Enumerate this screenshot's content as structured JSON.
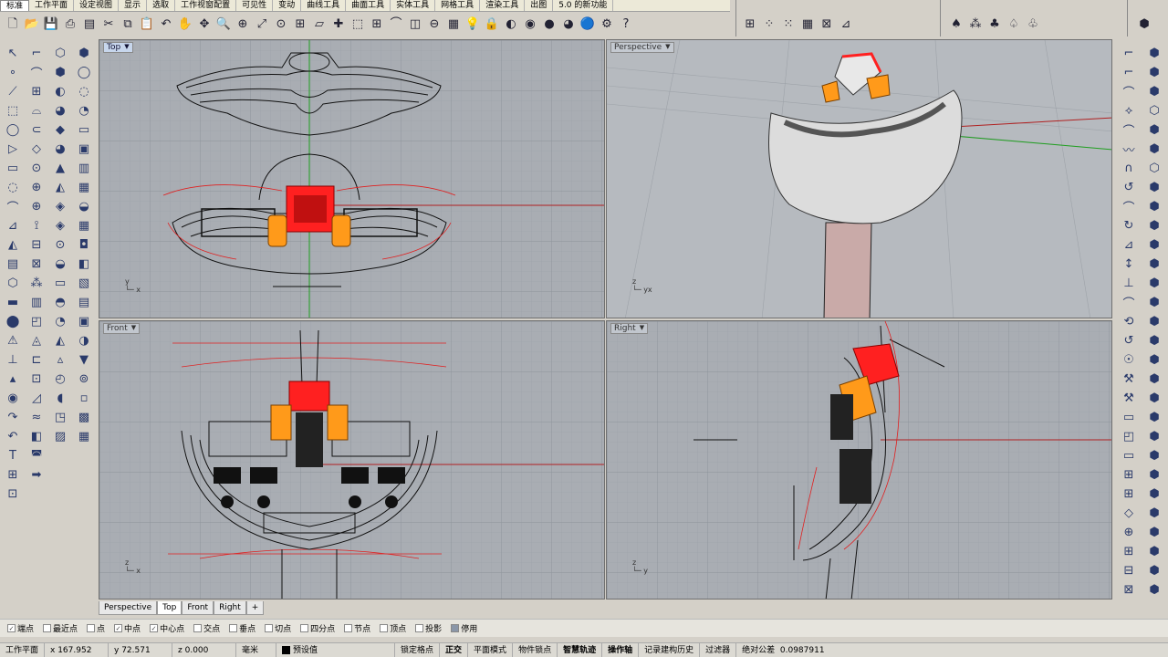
{
  "menu_tabs": [
    "标准",
    "工作平面",
    "设定视图",
    "显示",
    "选取",
    "工作视窗配置",
    "可见性",
    "变动",
    "曲线工具",
    "曲面工具",
    "实体工具",
    "网格工具",
    "渲染工具",
    "出图",
    "5.0 的新功能"
  ],
  "viewports": {
    "top": {
      "label": "Top",
      "axis_y": "y",
      "axis_x": "x"
    },
    "perspective": {
      "label": "Perspective",
      "axis_y": "z",
      "axis_x": "yx"
    },
    "front": {
      "label": "Front",
      "axis_y": "z",
      "axis_x": "x"
    },
    "right": {
      "label": "Right",
      "axis_y": "z",
      "axis_x": "y"
    }
  },
  "viewport_tabs": [
    "Perspective",
    "Top",
    "Front",
    "Right",
    "+"
  ],
  "osnaps": [
    {
      "label": "端点",
      "checked": true
    },
    {
      "label": "最近点",
      "checked": false
    },
    {
      "label": "点",
      "checked": false
    },
    {
      "label": "中点",
      "checked": true
    },
    {
      "label": "中心点",
      "checked": true
    },
    {
      "label": "交点",
      "checked": false
    },
    {
      "label": "垂点",
      "checked": false
    },
    {
      "label": "切点",
      "checked": false
    },
    {
      "label": "四分点",
      "checked": false
    },
    {
      "label": "节点",
      "checked": false
    },
    {
      "label": "顶点",
      "checked": false
    },
    {
      "label": "投影",
      "checked": false
    }
  ],
  "osnap_disable": "停用",
  "status": {
    "plane": "工作平面",
    "x": "x 167.952",
    "y": "y 72.571",
    "z": "z 0.000",
    "unit": "毫米",
    "layer": "预设值",
    "grid_snap": "锁定格点",
    "ortho": "正交",
    "planar": "平面模式",
    "osnap": "物件锁点",
    "smarttrack": "智慧轨迹",
    "gumball": "操作轴",
    "history": "记录建构历史",
    "filter": "过滤器",
    "tolerance_label": "绝对公差",
    "tolerance": "0.0987911"
  },
  "colors": {
    "viewport_bg": "#a9adb3",
    "grid": "#9aa0a7",
    "wire": "#111111",
    "selected": "#ff2020",
    "highlight": "#ff9a1a",
    "axis_x": "#b02020",
    "axis_y": "#20a020"
  }
}
